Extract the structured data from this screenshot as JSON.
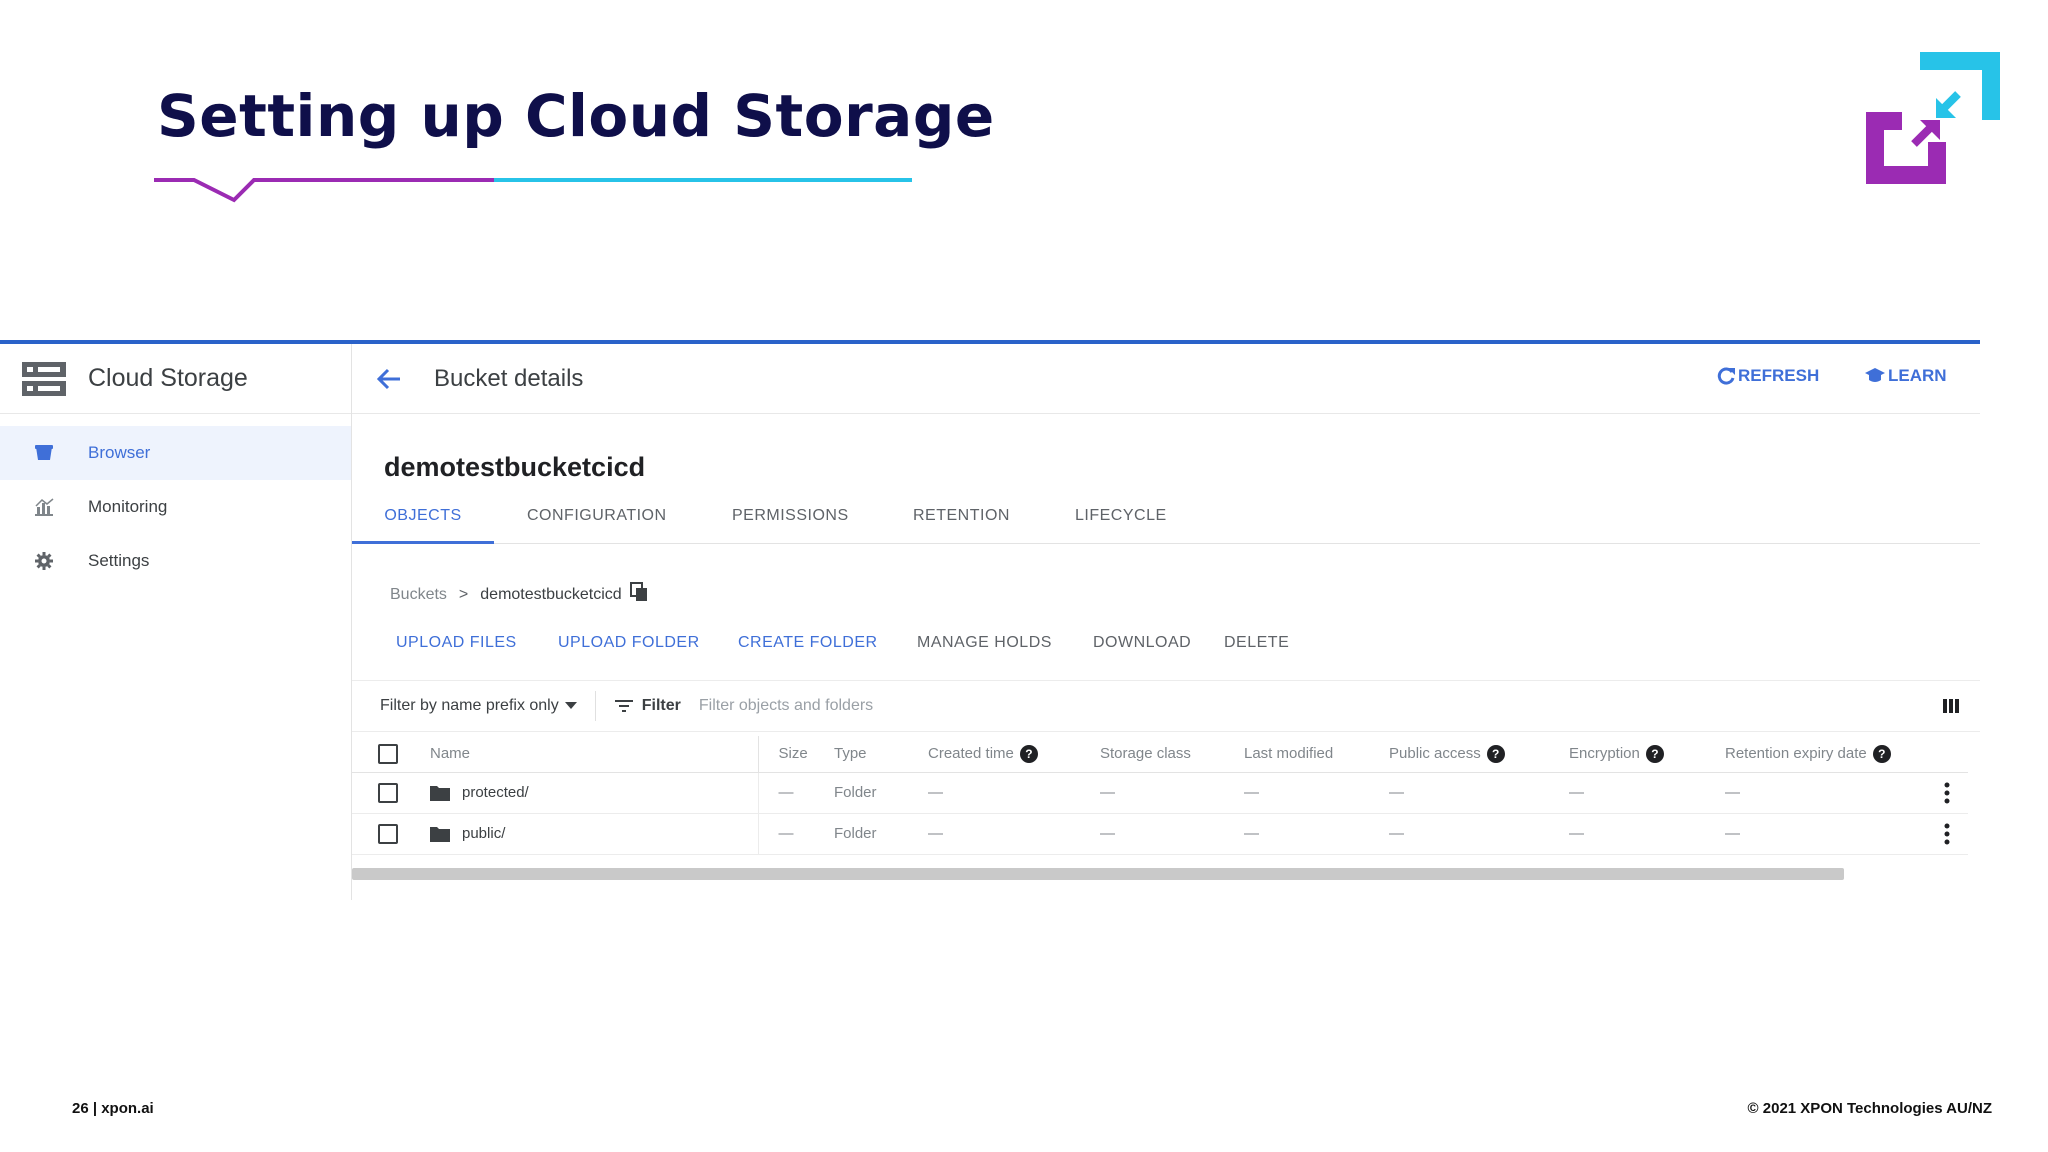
{
  "slide": {
    "title": "Setting up Cloud Storage",
    "footer_left": "26 | xpon.ai",
    "footer_right": "© 2021 XPON Technologies AU/NZ",
    "colors": {
      "title": "#0f0f4a",
      "purple": "#9b2bb3",
      "cyan": "#27c3e8"
    }
  },
  "console": {
    "app_title": "Cloud Storage",
    "sidebar": {
      "items": [
        {
          "label": "Browser",
          "icon": "bucket-icon",
          "active": true
        },
        {
          "label": "Monitoring",
          "icon": "chart-icon",
          "active": false
        },
        {
          "label": "Settings",
          "icon": "gear-icon",
          "active": false
        }
      ]
    },
    "page_heading": "Bucket details",
    "refresh_label": "REFRESH",
    "learn_label": "LEARN",
    "bucket_name": "demotestbucketcicd",
    "tabs": [
      {
        "label": "OBJECTS",
        "active": true
      },
      {
        "label": "CONFIGURATION",
        "active": false
      },
      {
        "label": "PERMISSIONS",
        "active": false
      },
      {
        "label": "RETENTION",
        "active": false
      },
      {
        "label": "LIFECYCLE",
        "active": false
      }
    ],
    "breadcrumb": {
      "root": "Buckets",
      "separator": ">",
      "current": "demotestbucketcicd"
    },
    "actions": [
      {
        "label": "UPLOAD FILES",
        "enabled": true
      },
      {
        "label": "UPLOAD FOLDER",
        "enabled": true
      },
      {
        "label": "CREATE FOLDER",
        "enabled": true
      },
      {
        "label": "MANAGE HOLDS",
        "enabled": false
      },
      {
        "label": "DOWNLOAD",
        "enabled": false
      },
      {
        "label": "DELETE",
        "enabled": false
      }
    ],
    "filter": {
      "mode": "Filter by name prefix only",
      "button": "Filter",
      "placeholder": "Filter objects and folders"
    },
    "table": {
      "columns": [
        "Name",
        "Size",
        "Type",
        "Created time",
        "Storage class",
        "Last modified",
        "Public access",
        "Encryption",
        "Retention expiry date"
      ],
      "rows": [
        {
          "name": "protected/",
          "size": "—",
          "type": "Folder",
          "created": "—",
          "storage_class": "—",
          "last_modified": "—",
          "public_access": "—",
          "encryption": "—",
          "retention": "—"
        },
        {
          "name": "public/",
          "size": "—",
          "type": "Folder",
          "created": "—",
          "storage_class": "—",
          "last_modified": "—",
          "public_access": "—",
          "encryption": "—",
          "retention": "—"
        }
      ]
    },
    "colors": {
      "accent": "#3f6fd8",
      "topline": "#2a62c9",
      "active_bg": "#eef3fd"
    }
  }
}
